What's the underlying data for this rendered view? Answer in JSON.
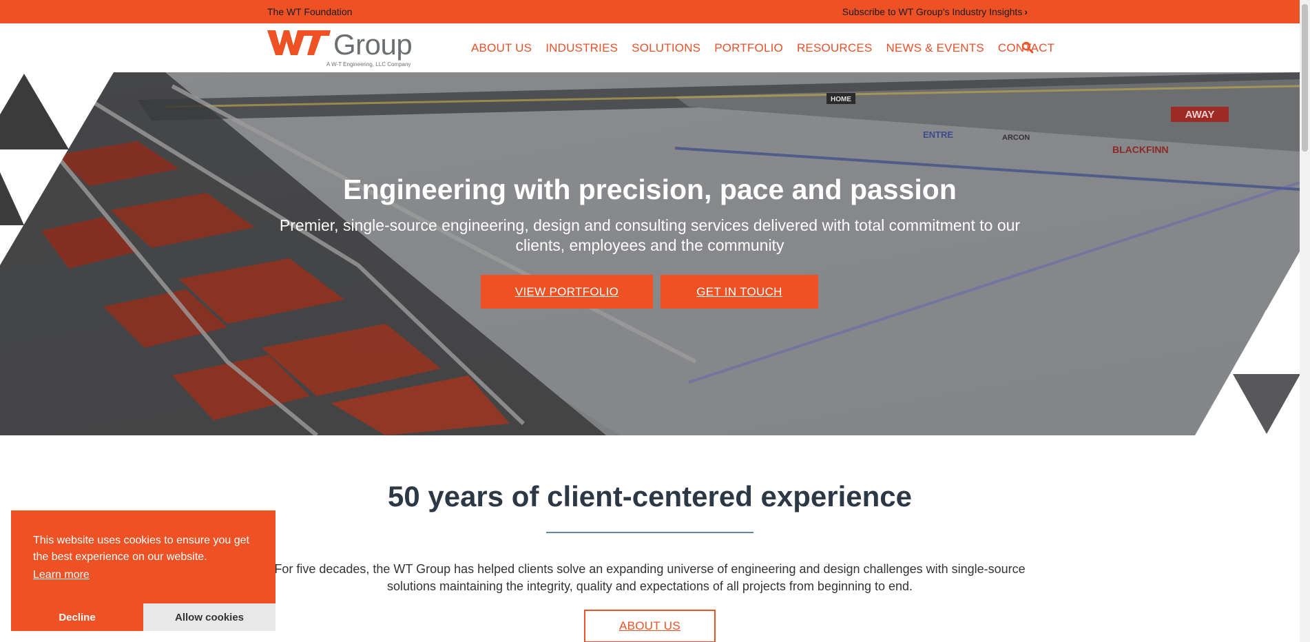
{
  "topbar": {
    "left_link": "The WT Foundation",
    "right_link": "Subscribe to WT Group's Industry Insights",
    "right_chevron": "›"
  },
  "logo": {
    "brand_wordmark": "WT",
    "brand_name": "Group",
    "tagline": "A W-T Engineering, LLC Company"
  },
  "nav": {
    "items": [
      "ABOUT US",
      "INDUSTRIES",
      "SOLUTIONS",
      "PORTFOLIO",
      "RESOURCES",
      "NEWS & EVENTS",
      "CONTACT"
    ],
    "search_icon": "search-icon"
  },
  "hero": {
    "title": "Engineering with precision, pace and passion",
    "subtitle": "Premier, single-source engineering, design and consulting services delivered with total commitment to our clients, employees and the community",
    "primary_button": "VIEW PORTFOLIO",
    "secondary_button": "GET IN TOUCH",
    "rink_signs": [
      "HOME",
      "AWAY",
      "BLACKFINN",
      "ENTRE",
      "ARCON"
    ]
  },
  "section": {
    "title": "50 years of client-centered experience",
    "body": "For five decades, the WT Group has helped clients solve an expanding universe of engineering and design challenges with single-source solutions maintaining the integrity, quality and expectations of all projects from beginning to end.",
    "button": "ABOUT US"
  },
  "cookie": {
    "message": "This website uses cookies to ensure you get the best experience on our website.",
    "learn_more": "Learn more",
    "decline": "Decline",
    "allow": "Allow cookies"
  },
  "colors": {
    "brand_orange": "#ee5224",
    "heading_dark": "#2c3845",
    "divider_blue": "#5b88a8",
    "logo_gray": "#6b6f72"
  }
}
